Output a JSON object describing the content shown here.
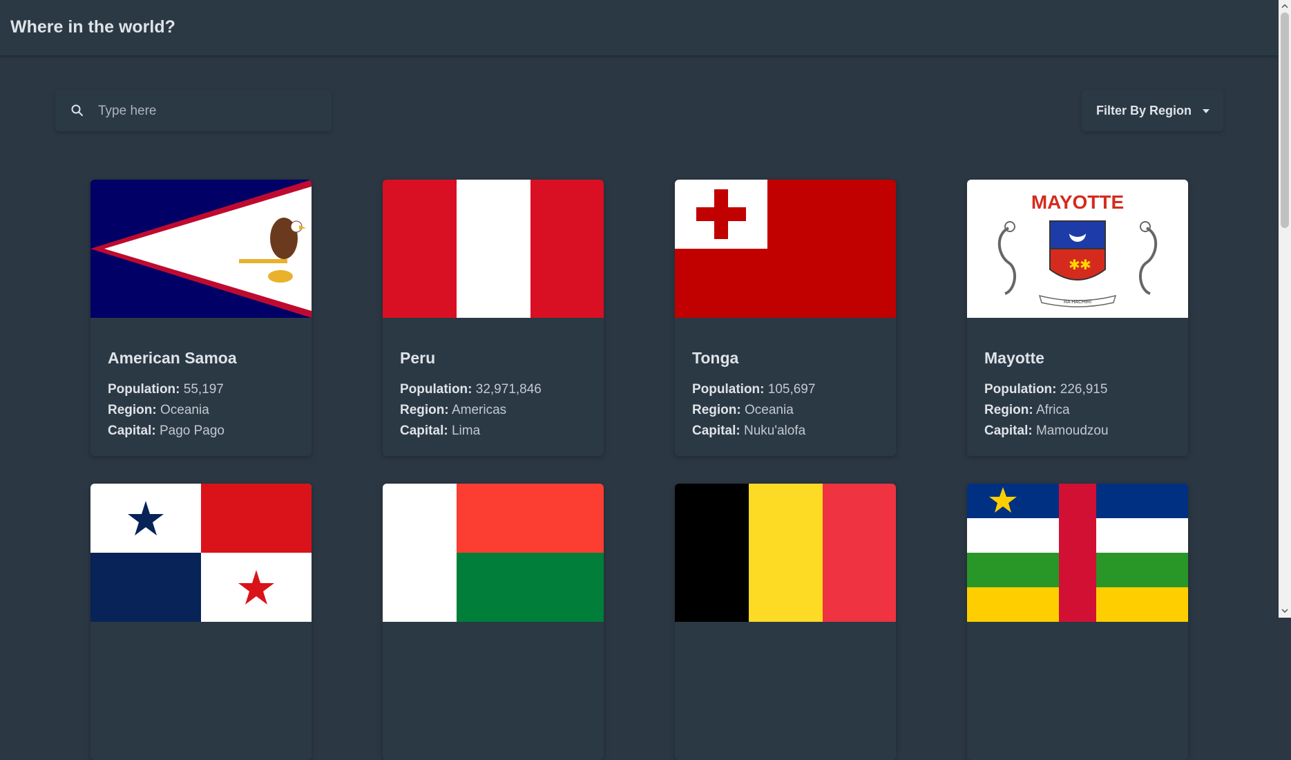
{
  "header": {
    "title": "Where in the world?"
  },
  "search": {
    "placeholder": "Type here",
    "value": ""
  },
  "filter": {
    "label": "Filter By Region"
  },
  "labels": {
    "population": "Population:",
    "region": "Region:",
    "capital": "Capital:"
  },
  "countries": [
    {
      "name": "American Samoa",
      "population": "55,197",
      "region": "Oceania",
      "capital": "Pago Pago",
      "flag": "american-samoa"
    },
    {
      "name": "Peru",
      "population": "32,971,846",
      "region": "Americas",
      "capital": "Lima",
      "flag": "peru"
    },
    {
      "name": "Tonga",
      "population": "105,697",
      "region": "Oceania",
      "capital": "Nuku'alofa",
      "flag": "tonga"
    },
    {
      "name": "Mayotte",
      "population": "226,915",
      "region": "Africa",
      "capital": "Mamoudzou",
      "flag": "mayotte"
    },
    {
      "flag": "panama"
    },
    {
      "flag": "madagascar"
    },
    {
      "flag": "belgium"
    },
    {
      "flag": "central-african-republic"
    }
  ],
  "flag_text": {
    "mayotte_banner": "MAYOTTE",
    "mayotte_motto": "RA HACHIRI"
  }
}
